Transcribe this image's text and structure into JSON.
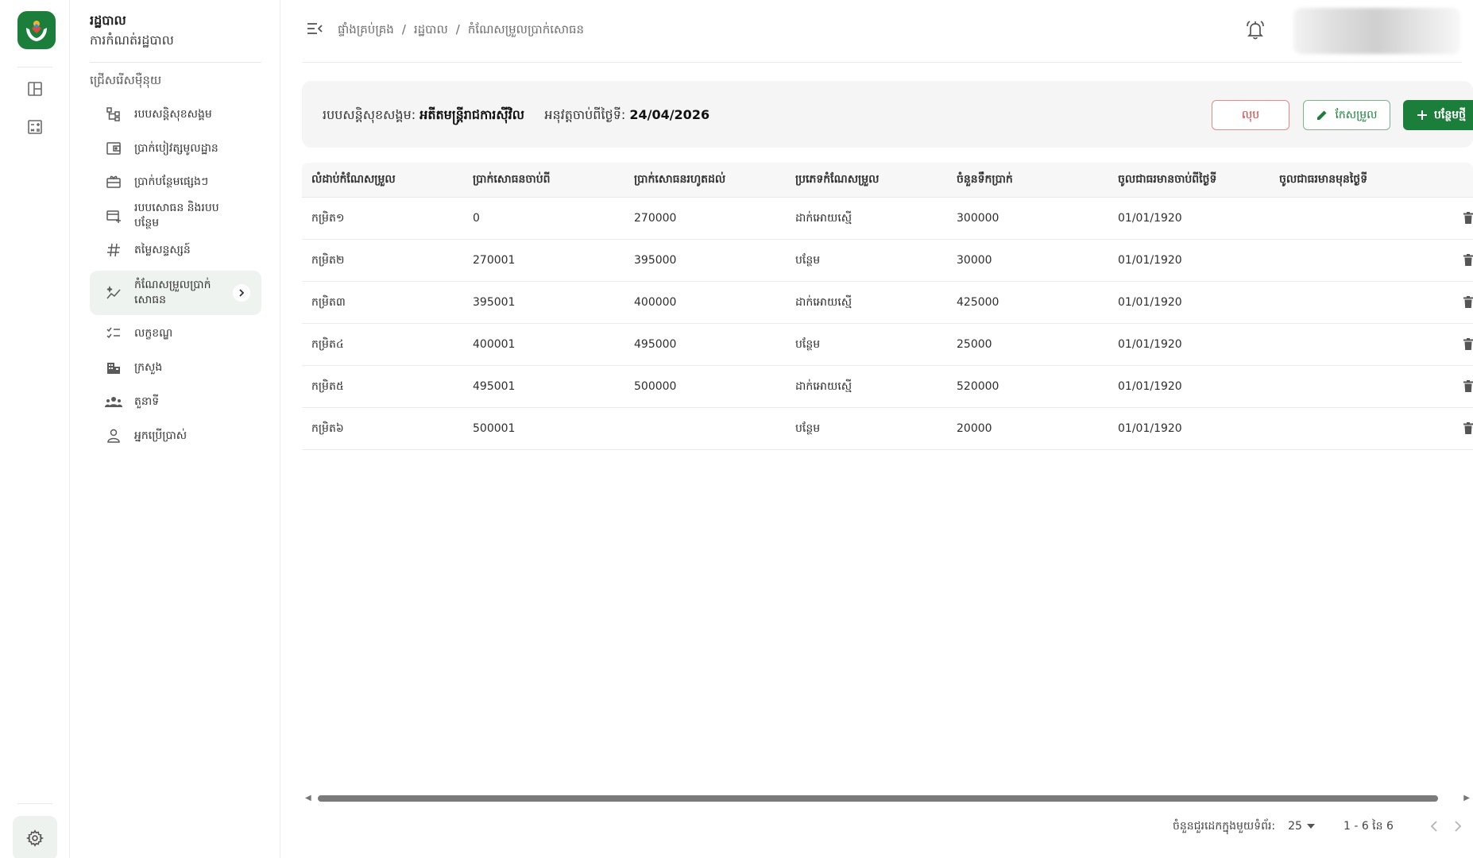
{
  "app": {
    "title": "រដ្ឋបាល",
    "subtitle": "ការកំណត់រដ្ឋបាល"
  },
  "sidebar": {
    "section_label": "ជ្រើសរើសម៉ឺនុយ",
    "items": [
      {
        "label": "របបសន្តិសុខសង្គម",
        "icon": "hierarchy-icon"
      },
      {
        "label": "ប្រាក់បៀវត្សមូលដ្ឋាន",
        "icon": "wallet-icon"
      },
      {
        "label": "ប្រាក់បន្ថែមផ្សេងៗ",
        "icon": "gift-icon"
      },
      {
        "label": "របបសោធន និងរបបបន្ថែម",
        "icon": "card-plus-icon"
      },
      {
        "label": "តម្លៃសន្ទស្សន៍",
        "icon": "hash-icon"
      },
      {
        "label": "កំណែសម្រួលប្រាក់សោធន",
        "icon": "sparkle-chart-icon",
        "active": true
      },
      {
        "label": "លក្ខខណ្ឌ",
        "icon": "checklist-icon"
      },
      {
        "label": "ក្រសួង",
        "icon": "building-icon"
      },
      {
        "label": "តួនាទី",
        "icon": "group-icon"
      },
      {
        "label": "អ្នកប្រើប្រាស់",
        "icon": "user-icon"
      }
    ]
  },
  "breadcrumb": [
    "ផ្ទាំងគ្រប់គ្រង",
    "/",
    "រដ្ឋបាល",
    "/",
    "កំណែសម្រួលប្រាក់សោធន"
  ],
  "info": {
    "scheme_label": "របបសន្តិសុខសង្គម:",
    "scheme_value": "អតីតមន្ត្រីរាជការស៊ីវិល",
    "effective_label": "អនុវត្តចាប់ពីថ្ងៃទី:",
    "effective_value": "24/04/2026"
  },
  "actions": {
    "delete": "លុប",
    "edit": "កែសម្រួល",
    "add": "បន្ថែមថ្មី"
  },
  "table": {
    "headers": [
      "លំដាប់កំណែសម្រួល",
      "ប្រាក់សោធនចាប់ពី",
      "ប្រាក់សោធនរហូតដល់",
      "ប្រភេទកំណែសម្រួល",
      "ចំនួនទឹកប្រាក់",
      "ចូលជាធរមានចាប់ពីថ្ងៃទី",
      "ចូលជាធរមានមុនថ្ងៃទី"
    ],
    "rows": [
      [
        "កម្រិត១",
        "0",
        "270000",
        "ដាក់អោយស្មើ",
        "300000",
        "01/01/1920",
        ""
      ],
      [
        "កម្រិត២",
        "270001",
        "395000",
        "បន្ថែម",
        "30000",
        "01/01/1920",
        ""
      ],
      [
        "កម្រិត៣",
        "395001",
        "400000",
        "ដាក់អោយស្មើ",
        "425000",
        "01/01/1920",
        ""
      ],
      [
        "កម្រិត៤",
        "400001",
        "495000",
        "បន្ថែម",
        "25000",
        "01/01/1920",
        ""
      ],
      [
        "កម្រិត៥",
        "495001",
        "500000",
        "ដាក់អោយស្មើ",
        "520000",
        "01/01/1920",
        ""
      ],
      [
        "កម្រិត៦",
        "500001",
        "",
        "បន្ថែម",
        "20000",
        "01/01/1920",
        ""
      ]
    ]
  },
  "pagination": {
    "rows_per_page_label": "ចំនួនជួរដេកក្នុងមួយទំព័រ:",
    "rows_per_page": "25",
    "range": "1 - 6 នៃ 6"
  },
  "colors": {
    "primary": "#1b7f3b",
    "danger": "#d23a3a",
    "active_bg": "#eef3ef"
  }
}
